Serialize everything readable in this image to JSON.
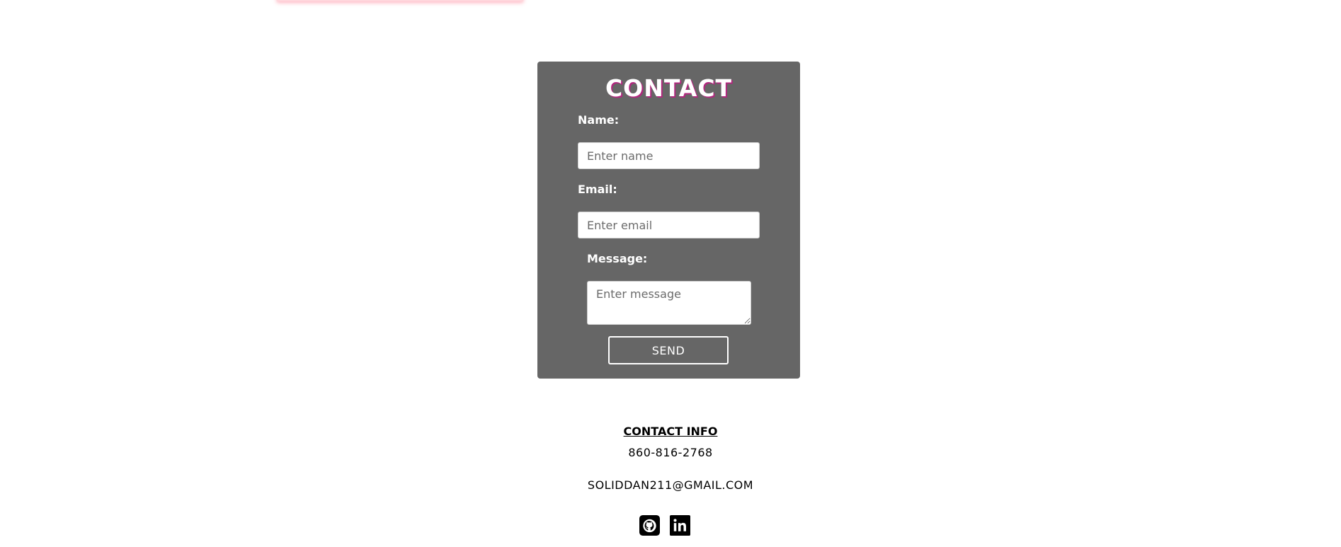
{
  "contact_form": {
    "title": "CONTACT",
    "name_label": "Name:",
    "name_placeholder": "Enter name",
    "email_label": "Email:",
    "email_placeholder": "Enter email",
    "message_label": "Message:",
    "message_placeholder": "Enter message",
    "send_label": "SEND"
  },
  "contact_info": {
    "heading": "CONTACT INFO",
    "phone": "860-816-2768",
    "email": "SOLIDDAN211@GMAIL.COM"
  },
  "social": {
    "icons": [
      "github-icon",
      "linkedin-icon"
    ]
  },
  "colors": {
    "card_background": "#666666",
    "title_shadow": "#b0287e",
    "text_light": "#ffffff",
    "text_dark": "#000000"
  }
}
